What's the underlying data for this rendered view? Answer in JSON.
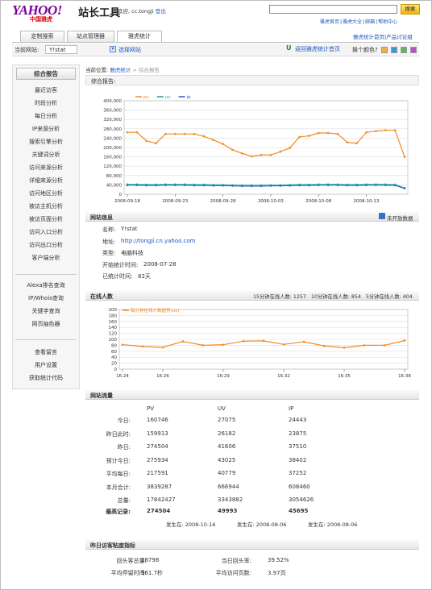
{
  "header": {
    "logo": "YAHOO!",
    "logo_cn": "中国雅虎",
    "site_name": "站长工具",
    "welcome": "欢迎, cc.tongji",
    "logout": "登出",
    "search_placeholder": "",
    "search_button": "搜索",
    "top_links": [
      "雅虎首页",
      "雅虎大全",
      "邮箱",
      "帮助中心"
    ]
  },
  "tabs": [
    "定制搜索",
    "站点管理器",
    "雅虎统计"
  ],
  "right_links": [
    "雅虎统计首页",
    "产品讨论组"
  ],
  "site_bar": {
    "current_label": "当前网站:",
    "current_site": "Y!stat",
    "select_site": "选择网站",
    "return_home": "返回雅虎统计首页",
    "skin_label": "换个颜色?",
    "skin_colors": [
      "#f0b040",
      "#3a9ad9",
      "#5cb85c",
      "#c04cc8"
    ]
  },
  "sidebar": {
    "title": "综合报告",
    "group1": [
      "最近访客",
      "时段分析",
      "每日分析",
      "IP来源分析",
      "搜索引擎分析",
      "关键词分析",
      "访问来源分析",
      "详细来源分析",
      "访问地区分析",
      "被访主机分析",
      "被访页面分析",
      "访问入口分析",
      "访问出口分析",
      "客户端分析"
    ],
    "group2": [
      "Alexa排名查询",
      "IP/Whois查询",
      "关键字查询",
      "网页抽色器"
    ],
    "group3": [
      "查看留言",
      "用户设置",
      "获取统计代码"
    ]
  },
  "breadcrumb": {
    "prefix": "当前位置:",
    "link": "雅虎统计",
    "sep": ">",
    "current": "综合报告"
  },
  "panel_title": "综合报告:",
  "chart_data": [
    {
      "type": "line",
      "legend": [
        "pv",
        "uv",
        "ip"
      ],
      "colors": [
        "#f08a24",
        "#1aa0a0",
        "#2f5fbf"
      ],
      "x_tick_labels": [
        "2008-09-18",
        "2008-09-23",
        "2008-09-28",
        "2008-10-03",
        "2008-10-08",
        "2008-10-13"
      ],
      "ylim": [
        0,
        400000
      ],
      "y_ticks": [
        "0",
        "40,000",
        "80,000",
        "120,000",
        "160,000",
        "200,000",
        "240,000",
        "280,000",
        "320,000",
        "360,000",
        "400,000"
      ],
      "series": [
        {
          "name": "pv",
          "values": [
            265000,
            265000,
            228000,
            218000,
            258000,
            258000,
            258000,
            258000,
            248000,
            232000,
            215000,
            190000,
            175000,
            162000,
            168000,
            168000,
            182000,
            198000,
            245000,
            250000,
            262000,
            262000,
            258000,
            222000,
            218000,
            265000,
            270000,
            274000,
            274000,
            160000
          ]
        },
        {
          "name": "uv",
          "values": [
            42000,
            42000,
            41000,
            41000,
            42000,
            42000,
            42000,
            41000,
            41000,
            40000,
            40000,
            39000,
            38000,
            38000,
            38000,
            39000,
            39000,
            40000,
            41000,
            41000,
            42000,
            42000,
            42000,
            41000,
            41000,
            42000,
            42000,
            42000,
            41000,
            27000
          ]
        },
        {
          "name": "ip",
          "values": [
            39000,
            39000,
            38000,
            38000,
            39000,
            39000,
            39000,
            38000,
            38000,
            37000,
            37000,
            36000,
            35000,
            35000,
            35000,
            36000,
            36000,
            37000,
            38000,
            38000,
            39000,
            39000,
            39000,
            38000,
            38000,
            39000,
            39000,
            39000,
            38000,
            25000
          ]
        }
      ]
    },
    {
      "type": "line",
      "legend": [
        "每分钟在线人数趋势(uv)"
      ],
      "colors": [
        "#f08a24"
      ],
      "x_tick_labels": [
        "16:24",
        "16:26",
        "16:29",
        "16:32",
        "16:35",
        "16:38"
      ],
      "ylim": [
        0,
        200
      ],
      "y_ticks": [
        "0",
        "20",
        "40",
        "60",
        "80",
        "100",
        "120",
        "140",
        "160",
        "180",
        "200"
      ],
      "series": [
        {
          "name": "每分钟在线人数趋势(uv)",
          "values": [
            82,
            76,
            73,
            93,
            80,
            82,
            94,
            95,
            83,
            92,
            78,
            72,
            80,
            80,
            96
          ]
        }
      ]
    }
  ],
  "site_info": {
    "title": "网站信息",
    "unpublished": "未开放数据",
    "rows": [
      {
        "label": "名称:",
        "value": "Y!stat"
      },
      {
        "label": "地址:",
        "value": "http://tongji.cn.yahoo.com"
      },
      {
        "label": "类型:",
        "value": "电脑科技"
      },
      {
        "label": "开始统计时间:",
        "value": "2008-07-28"
      },
      {
        "label": "已统计时间:",
        "value": "82天"
      }
    ]
  },
  "online": {
    "title": "在线人数",
    "stats": "15分钟在线人数: 1257   10分钟在线人数: 854   5分钟在线人数: 404"
  },
  "traffic": {
    "title": "网站流量",
    "headers": [
      "",
      "PV",
      "UV",
      "IP"
    ],
    "rows": [
      [
        "今日:",
        "160746",
        "27075",
        "24443"
      ],
      [
        "昨日此时:",
        "159913",
        "26182",
        "23875"
      ],
      [
        "昨日:",
        "274504",
        "41606",
        "37510"
      ],
      [
        "预计今日:",
        "275934",
        "43025",
        "38402"
      ],
      [
        "平均每日:",
        "217591",
        "40779",
        "37252"
      ],
      [
        "本月合计:",
        "3839287",
        "666944",
        "608460"
      ],
      [
        "总量:",
        "17842427",
        "3343882",
        "3054626"
      ]
    ],
    "max_label": "最高记录:",
    "max": [
      "274504",
      "49993",
      "45695"
    ],
    "max_dates": [
      "发生在: 2008-10-16",
      "发生在: 2008-08-06",
      "发生在: 2008-08-06"
    ]
  },
  "yesterday": {
    "title": "昨日访客粘度指标",
    "rows": [
      {
        "l1": "回头客总量:",
        "v1": "18798",
        "l2": "当日回头率:",
        "v2": "39.52%"
      },
      {
        "l1": "平均停留时间:",
        "v1": "561.7秒",
        "l2": "平均访问页数:",
        "v2": "3.97页"
      }
    ]
  }
}
